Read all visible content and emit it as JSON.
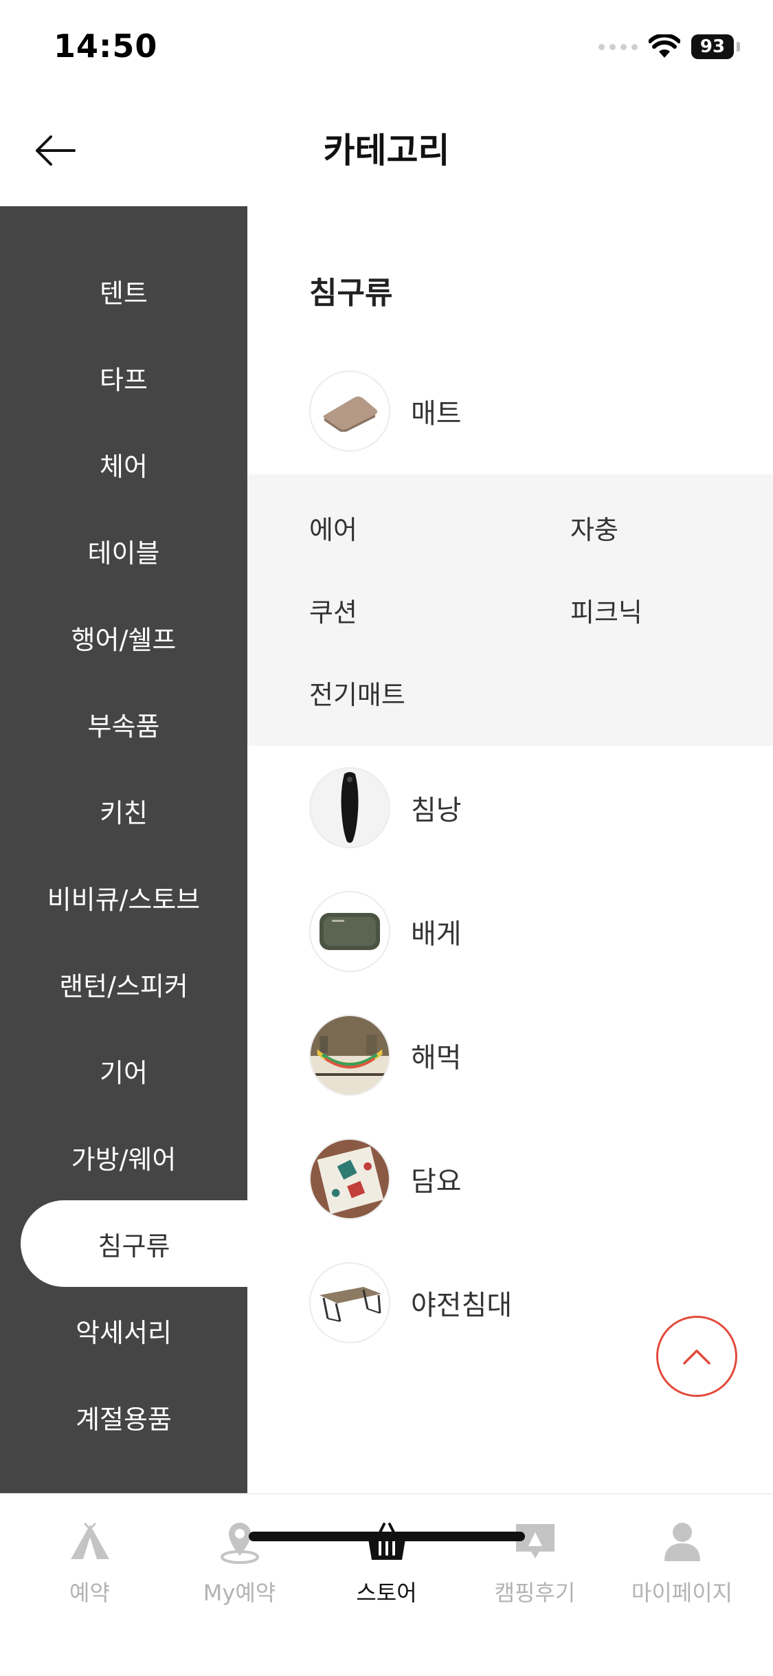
{
  "status_bar": {
    "time": "14:50",
    "battery": "93"
  },
  "header": {
    "title": "카테고리"
  },
  "sidebar": {
    "items": [
      {
        "label": "텐트",
        "active": false
      },
      {
        "label": "타프",
        "active": false
      },
      {
        "label": "체어",
        "active": false
      },
      {
        "label": "테이블",
        "active": false
      },
      {
        "label": "행어/쉘프",
        "active": false
      },
      {
        "label": "부속품",
        "active": false
      },
      {
        "label": "키친",
        "active": false
      },
      {
        "label": "비비큐/스토브",
        "active": false
      },
      {
        "label": "랜턴/스피커",
        "active": false
      },
      {
        "label": "기어",
        "active": false
      },
      {
        "label": "가방/웨어",
        "active": false
      },
      {
        "label": "침구류",
        "active": true
      },
      {
        "label": "악세서리",
        "active": false
      },
      {
        "label": "계절용품",
        "active": false
      }
    ]
  },
  "content": {
    "section_title": "침구류",
    "categories": [
      {
        "label": "매트",
        "icon": "mat-thumbnail"
      },
      {
        "label": "침낭",
        "icon": "sleeping-bag-thumbnail"
      },
      {
        "label": "배게",
        "icon": "pillow-thumbnail"
      },
      {
        "label": "해먹",
        "icon": "hammock-thumbnail"
      },
      {
        "label": "담요",
        "icon": "blanket-thumbnail"
      },
      {
        "label": "야전침대",
        "icon": "cot-thumbnail"
      }
    ],
    "subcategories": [
      "에어",
      "자충",
      "쿠션",
      "피크닉",
      "전기매트"
    ]
  },
  "tab_bar": {
    "tabs": [
      {
        "label": "예약",
        "icon": "tent-icon",
        "active": false
      },
      {
        "label": "My예약",
        "icon": "location-pin-icon",
        "active": false
      },
      {
        "label": "스토어",
        "icon": "basket-icon",
        "active": true
      },
      {
        "label": "캠핑후기",
        "icon": "review-icon",
        "active": false
      },
      {
        "label": "마이페이지",
        "icon": "person-icon",
        "active": false
      }
    ]
  },
  "colors": {
    "sidebar_bg": "#454545",
    "accent": "#e24a3b",
    "subpanel_bg": "#f5f5f5",
    "tab_inactive": "#b3b3b3"
  }
}
